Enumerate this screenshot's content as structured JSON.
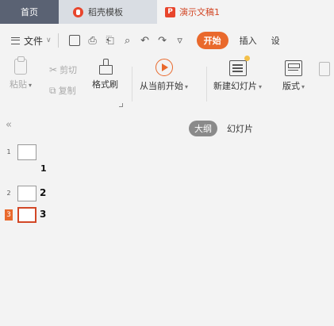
{
  "tabs": {
    "home": "首页",
    "template": "稻壳模板",
    "document": "演示文稿1"
  },
  "menu": {
    "file": "文件",
    "start": "开始",
    "insert": "插入",
    "design": "设"
  },
  "ribbon": {
    "paste": "粘贴",
    "cut": "剪切",
    "copy": "复制",
    "format_painter": "格式刷",
    "play_from_current": "从当前开始",
    "new_slide": "新建幻灯片",
    "layout": "版式"
  },
  "outline_pane": {
    "view_outline": "大纲",
    "view_slides": "幻灯片",
    "slides": [
      {
        "number": "1",
        "title": "1"
      },
      {
        "number": "2",
        "title": "2"
      },
      {
        "number": "3",
        "title": "3"
      }
    ]
  },
  "colors": {
    "accent": "#e9692c",
    "active_border": "#d24726"
  }
}
